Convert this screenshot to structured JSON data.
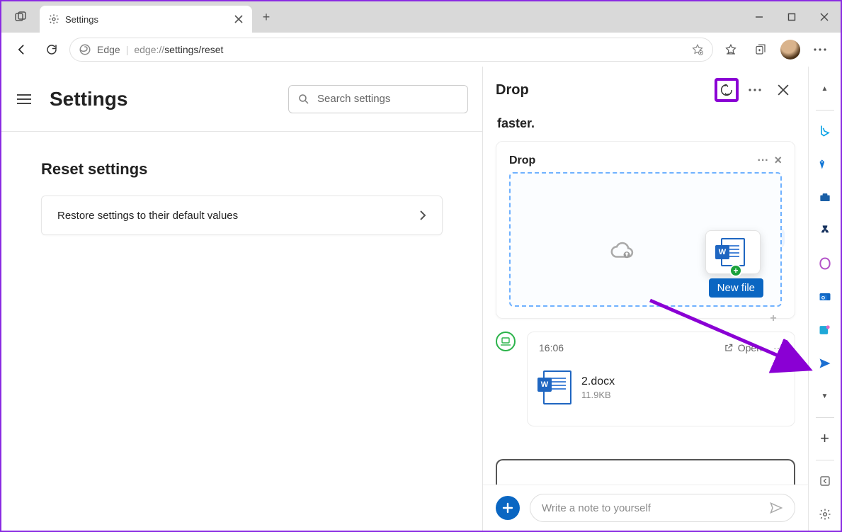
{
  "tab": {
    "title": "Settings"
  },
  "address": {
    "edge_label": "Edge",
    "url_prefix": "edge://",
    "url_path": "settings/reset"
  },
  "settings": {
    "page_title": "Settings",
    "search_placeholder": "Search settings",
    "section_title": "Reset settings",
    "option_restore": "Restore settings to their default values"
  },
  "drop": {
    "title": "Drop",
    "tip_tail": "faster.",
    "mini_title": "Drop",
    "new_file_label": "New file",
    "message": {
      "time": "16:06",
      "open_label": "Open",
      "file_name": "2.docx",
      "file_size": "11.9KB"
    },
    "compose_placeholder": "Write a note to yourself"
  }
}
